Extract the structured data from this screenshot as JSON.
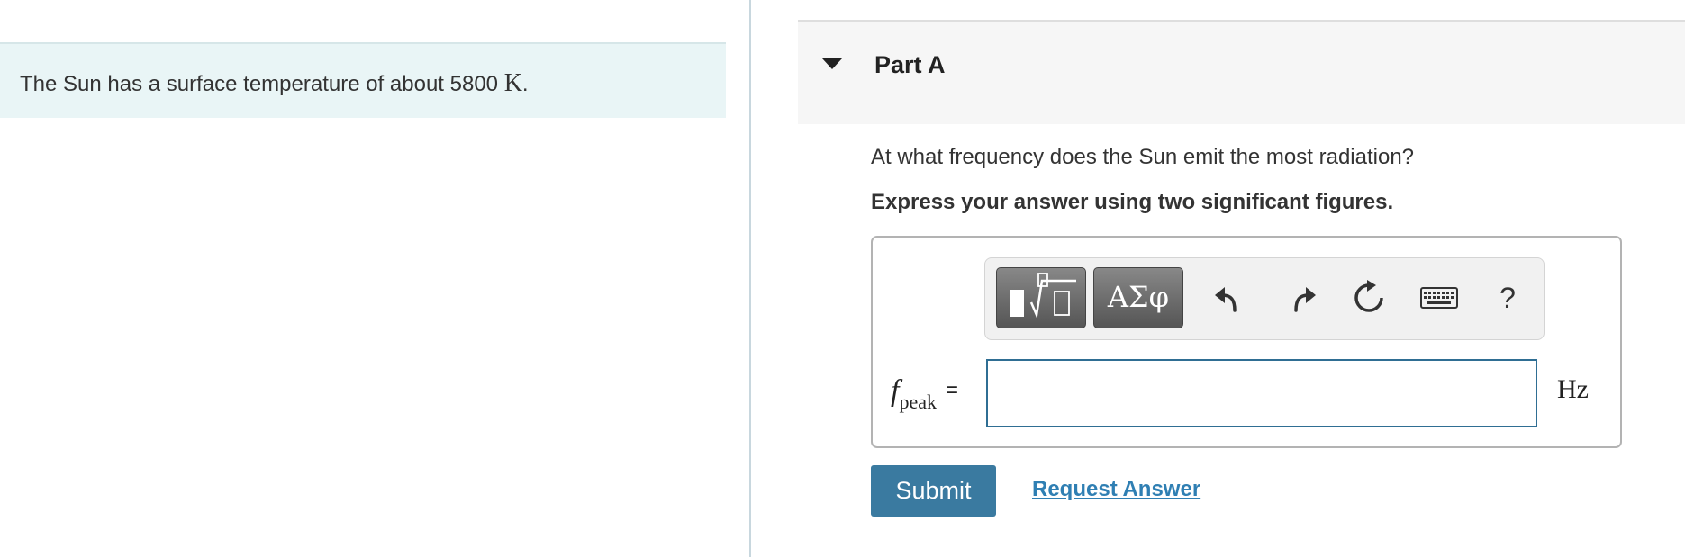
{
  "problem": {
    "text": "The Sun has a surface temperature of about 5800 ",
    "unit": "K",
    "end": "."
  },
  "part": {
    "title": "Part A"
  },
  "question": {
    "text": "At what frequency does the Sun emit the most radiation?"
  },
  "instruction": {
    "text": "Express your answer using two significant figures."
  },
  "toolbar": {
    "symbols_label": "ΑΣφ",
    "help_label": "?",
    "icons": [
      "templates-icon",
      "greek-symbols-icon",
      "undo-icon",
      "redo-icon",
      "reset-icon",
      "keyboard-icon",
      "help-icon"
    ]
  },
  "answer": {
    "variable": "f",
    "subscript": "peak",
    "equals": "=",
    "value": "",
    "unit": "Hz"
  },
  "actions": {
    "submit_label": "Submit",
    "request_label": "Request Answer"
  },
  "colors": {
    "accent": "#3a7aa0",
    "link": "#2f7fb3",
    "problem_bg": "#e9f5f6",
    "input_border": "#2f6e93"
  }
}
